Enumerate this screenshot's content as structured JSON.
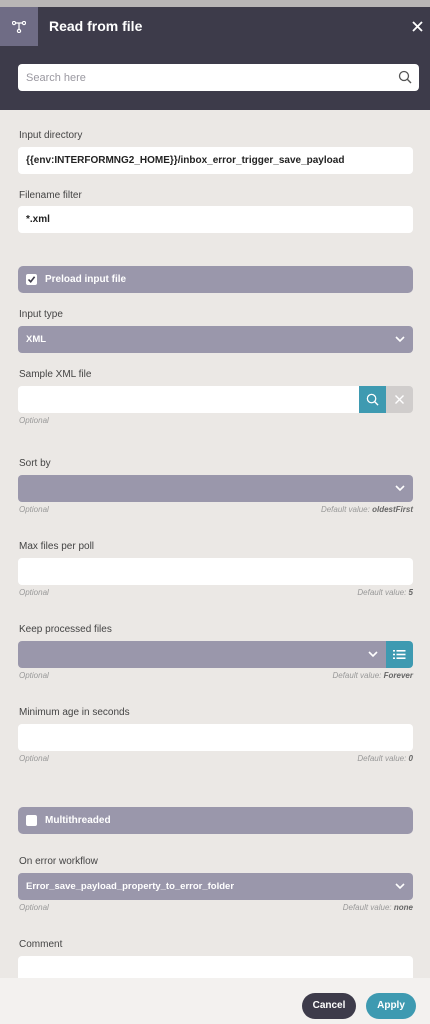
{
  "header": {
    "title": "Read from file",
    "icon": "workflow-node-icon",
    "search_placeholder": "Search here"
  },
  "form": {
    "input_directory": {
      "label": "Input directory",
      "value": "{{env:INTERFORMNG2_HOME}}/inbox_error_trigger_save_payload"
    },
    "filename_filter": {
      "label": "Filename filter",
      "value": "*.xml"
    },
    "preload_input_file": {
      "label": "Preload input file",
      "checked": true
    },
    "input_type": {
      "label": "Input type",
      "value": "XML"
    },
    "sample_xml_file": {
      "label": "Sample XML file",
      "value": "",
      "hint": "Optional"
    },
    "sort_by": {
      "label": "Sort by",
      "value": "",
      "hint": "Optional",
      "default_prefix": "Default value:",
      "default_value": "oldestFirst"
    },
    "max_files_per_poll": {
      "label": "Max files per poll",
      "value": "",
      "hint": "Optional",
      "default_prefix": "Default value:",
      "default_value": "5"
    },
    "keep_processed_files": {
      "label": "Keep processed files",
      "value": "",
      "hint": "Optional",
      "default_prefix": "Default value:",
      "default_value": "Forever"
    },
    "minimum_age_seconds": {
      "label": "Minimum age in seconds",
      "value": "",
      "hint": "Optional",
      "default_prefix": "Default value:",
      "default_value": "0"
    },
    "multithreaded": {
      "label": "Multithreaded",
      "checked": false
    },
    "on_error_workflow": {
      "label": "On error workflow",
      "value": "Error_save_payload_property_to_error_folder",
      "hint": "Optional",
      "default_prefix": "Default value:",
      "default_value": "none"
    },
    "comment": {
      "label": "Comment",
      "value": ""
    }
  },
  "footer": {
    "cancel_label": "Cancel",
    "apply_label": "Apply"
  },
  "colors": {
    "header_bg": "#3d3b4a",
    "select_bg": "#9a97ab",
    "accent_teal": "#3e9ab1",
    "cancel_bg": "#3d3b4a"
  }
}
